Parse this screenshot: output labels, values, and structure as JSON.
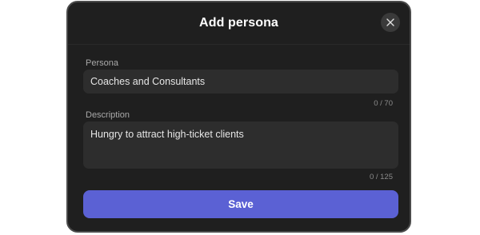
{
  "dialog": {
    "title": "Add persona",
    "close_icon": "close-icon"
  },
  "persona": {
    "label": "Persona",
    "value": "Coaches and Consultants",
    "counter": "0 / 70"
  },
  "description": {
    "label": "Description",
    "value": "Hungry to attract high-ticket clients",
    "counter": "0 / 125"
  },
  "actions": {
    "save_label": "Save"
  },
  "colors": {
    "modal_background": "#1f1f1f",
    "input_background": "#2d2d2d",
    "save_button": "#5b61d4"
  }
}
